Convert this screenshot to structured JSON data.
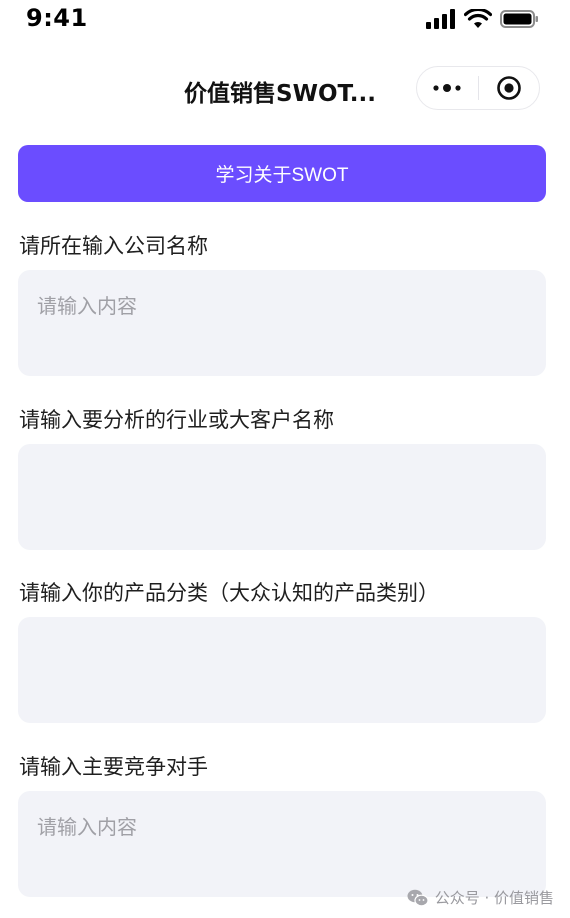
{
  "status_bar": {
    "time": "9:41",
    "icons": [
      "signal-icon",
      "wifi-icon",
      "battery-icon"
    ]
  },
  "nav": {
    "title": "价值销售SWOT...",
    "menu_icon": "more-dots-icon",
    "close_icon": "target-icon"
  },
  "learn_button": {
    "label": "学习关于SWOT",
    "color": "#6b4dff"
  },
  "fields": [
    {
      "label": "请所在输入公司名称",
      "placeholder": "请输入内容",
      "value": ""
    },
    {
      "label": "请输入要分析的行业或大客户名称",
      "placeholder": "",
      "value": ""
    },
    {
      "label": "请输入你的产品分类（大众认知的产品类别）",
      "placeholder": "",
      "value": ""
    },
    {
      "label": "请输入主要竞争对手",
      "placeholder": "请输入内容",
      "value": ""
    }
  ],
  "watermark": {
    "text": "公众号 · 价值销售",
    "icon": "wechat-icon"
  },
  "colors": {
    "accent": "#6b4dff",
    "input_bg": "#f2f3f8",
    "placeholder": "#a0a0a6"
  }
}
